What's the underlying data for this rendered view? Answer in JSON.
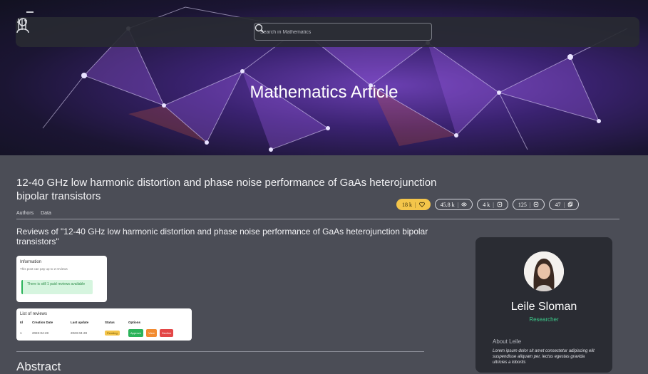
{
  "topbar": {
    "search_placeholder": "Search in Mathematics"
  },
  "hero": {
    "title": "Mathematics Article"
  },
  "article": {
    "title": "12-40 GHz low harmonic distortion and phase noise performance of GaAs heterojunction bipolar transistors",
    "tabs": [
      "Authors",
      "Data"
    ]
  },
  "stats": [
    {
      "value": "18 k",
      "icon": "heart-icon",
      "highlighted": true
    },
    {
      "value": "45.8 k",
      "icon": "eye-icon"
    },
    {
      "value": "4 k",
      "icon": "download-icon"
    },
    {
      "value": "125",
      "icon": "comment-icon"
    },
    {
      "value": "47",
      "icon": "share-icon"
    }
  ],
  "reviews": {
    "title": "Reviews of \"12-40 GHz low harmonic distortion and phase noise performance of GaAs heterojunction bipolar transistors\"",
    "info": {
      "heading": "Information",
      "subtext": "This post can pay up to 2 reviews",
      "note": "There is still 1 paid reviews available"
    },
    "list": {
      "heading": "List of reviews",
      "columns": [
        "Id",
        "Creation Date",
        "Last update",
        "Status",
        "Options"
      ],
      "rows": [
        {
          "id": "1",
          "created": "2023-04-28",
          "updated": "2023-04-28",
          "status": "Pending"
        }
      ],
      "actions": {
        "approve": "Approve",
        "view": "View",
        "decline": "Decline"
      }
    }
  },
  "abstract": {
    "heading": "Abstract"
  },
  "profile": {
    "name": "Leile Sloman",
    "role": "Researcher",
    "about_heading": "About Leile",
    "bio": "Lorem ipsum dolor sit amet consectetur adipiscing elit suspendisse aliquam per, lectus egestas gravida ultricies a lobortis"
  },
  "colors": {
    "accent_yellow": "#f4c54a",
    "role_green": "#3cc98a",
    "approve": "#2bb35a",
    "view": "#f28b30",
    "decline": "#e34747"
  }
}
